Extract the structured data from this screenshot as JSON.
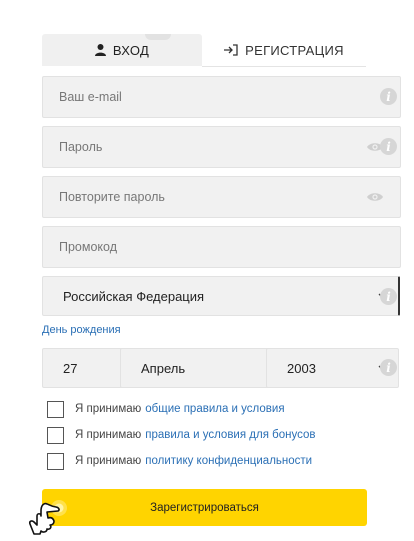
{
  "tabs": {
    "login_label": "ВХОД",
    "register_label": "РЕГИСТРАЦИЯ"
  },
  "fields": {
    "email_placeholder": "Ваш e-mail",
    "password_placeholder": "Пароль",
    "repeat_password_placeholder": "Повторите пароль",
    "promo_placeholder": "Промокод",
    "country_value": "Российская Федерация"
  },
  "birthday": {
    "label": "День рождения",
    "day": "27",
    "month": "Апрель",
    "year": "2003"
  },
  "checkboxes": [
    {
      "prefix": "Я принимаю",
      "link": "общие правила и условия",
      "checked": false
    },
    {
      "prefix": "Я принимаю",
      "link": "правила и условия для бонусов",
      "checked": false
    },
    {
      "prefix": "Я принимаю",
      "link": "политику конфиденциальности",
      "checked": false
    }
  ],
  "submit_label": "Зарегистрироваться",
  "colors": {
    "accent_yellow": "#ffd400",
    "link_blue": "#2a6fb5",
    "field_bg": "#f1f1f1",
    "info_icon": "#d6d6d6"
  },
  "icons": {
    "login": "user-icon",
    "register": "sign-in-arrow-icon",
    "eye": "eye-icon",
    "info": "info-icon",
    "chevron": "chevron-down-icon",
    "cursor": "hand-pointer-icon"
  }
}
